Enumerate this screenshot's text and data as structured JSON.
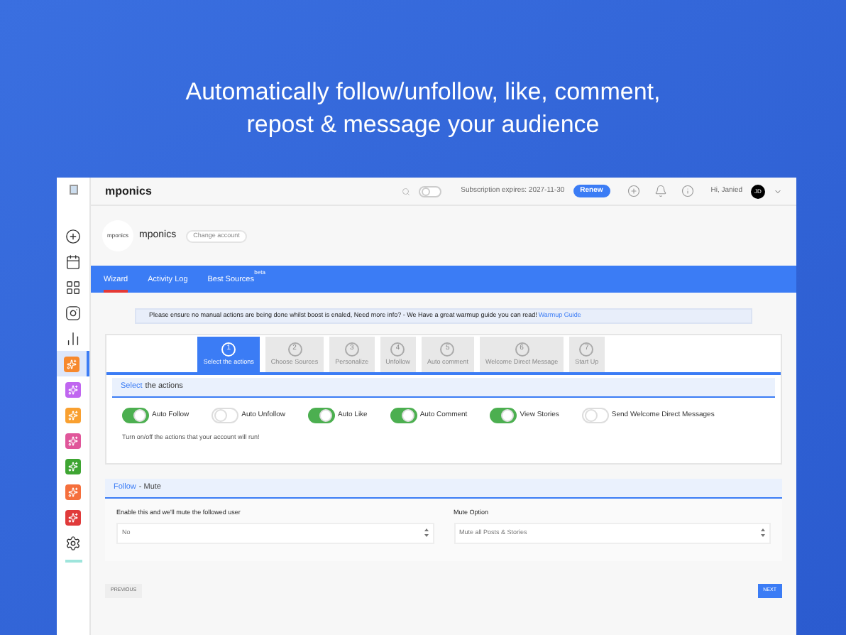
{
  "headline": "Automatically follow/unfollow, like, comment, repost & message your audience",
  "topbar": {
    "brand": "mponics",
    "boost_on": false,
    "subscription": "Subscription expires: 2027-11-30",
    "renew": "Renew",
    "greeting": "Hi, Janied",
    "avatar": "JD"
  },
  "sidebar": {
    "items": [
      {
        "kind": "plus",
        "selected": false
      },
      {
        "kind": "calendar",
        "selected": false
      },
      {
        "kind": "grid",
        "selected": false
      },
      {
        "kind": "instagram",
        "selected": false
      },
      {
        "kind": "chart",
        "selected": false
      },
      {
        "kind": "app",
        "color": "#f7892e",
        "selected": true
      },
      {
        "kind": "app",
        "color": "#c066f0",
        "selected": false
      },
      {
        "kind": "app",
        "color": "#f9a030",
        "selected": false
      },
      {
        "kind": "app",
        "color": "#e0569a",
        "selected": false
      },
      {
        "kind": "app",
        "color": "#3ea532",
        "selected": false
      },
      {
        "kind": "app",
        "color": "#f56f3c",
        "selected": false
      },
      {
        "kind": "app",
        "color": "#e03a3a",
        "selected": false
      },
      {
        "kind": "gear",
        "selected": false
      }
    ]
  },
  "account": {
    "logo": "mponics",
    "name": "mponics",
    "change": "Change account"
  },
  "tabs": [
    {
      "label": "Wizard",
      "selected": true
    },
    {
      "label": "Activity Log",
      "selected": false
    },
    {
      "label": "Best Sources",
      "badge": "beta",
      "selected": false
    }
  ],
  "notice": {
    "text": "Please ensure no manual actions are being done whilst boost is enaled, Need more info? - We Have a great warmup guide you can read!",
    "link": "Warmup Guide"
  },
  "steps": [
    {
      "number": "1",
      "label": "Select the actions",
      "selected": true
    },
    {
      "number": "2",
      "label": "Choose Sources",
      "selected": false
    },
    {
      "number": "3",
      "label": "Personalize",
      "selected": false
    },
    {
      "number": "4",
      "label": "Unfollow",
      "selected": false
    },
    {
      "number": "5",
      "label": "Auto comment",
      "selected": false
    },
    {
      "number": "6",
      "label": "Welcome Direct Message",
      "selected": false
    },
    {
      "number": "7",
      "label": "Start Up",
      "selected": false
    }
  ],
  "actions_section": {
    "title_highlight": "Select",
    "title_rest": "the actions",
    "hint": "Turn on/off the actions that your account will run!",
    "toggles": [
      {
        "label": "Auto Follow",
        "on": true
      },
      {
        "label": "Auto Unfollow",
        "on": false
      },
      {
        "label": "Auto Like",
        "on": true
      },
      {
        "label": "Auto Comment",
        "on": true
      },
      {
        "label": "View Stories",
        "on": true
      },
      {
        "label": "Send Welcome Direct Messages",
        "on": false
      }
    ]
  },
  "mute_section": {
    "title_highlight": "Follow",
    "title_rest": "- Mute",
    "fields": [
      {
        "label": "Enable this and we'll mute the followed user",
        "value": "No"
      },
      {
        "label": "Mute Option",
        "value": "Mute all Posts & Stories"
      }
    ]
  },
  "buttons": [
    {
      "label": "PREVIOUS",
      "kind": "secondary"
    },
    {
      "label": "NEXT",
      "kind": "primary"
    }
  ]
}
